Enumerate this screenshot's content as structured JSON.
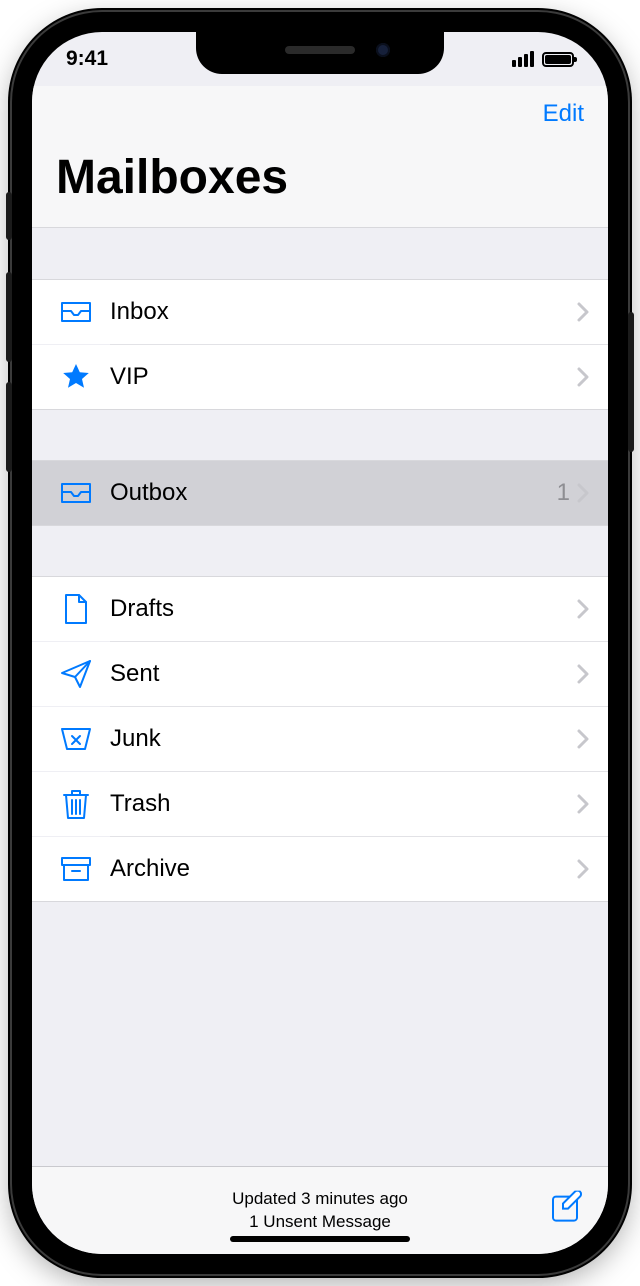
{
  "statusbar": {
    "time": "9:41"
  },
  "nav": {
    "edit": "Edit"
  },
  "title": "Mailboxes",
  "sections": [
    {
      "rows": [
        {
          "id": "inbox",
          "icon": "tray",
          "label": "Inbox",
          "count": "",
          "selected": false
        },
        {
          "id": "vip",
          "icon": "star",
          "label": "VIP",
          "count": "",
          "selected": false
        }
      ]
    },
    {
      "rows": [
        {
          "id": "outbox",
          "icon": "tray",
          "label": "Outbox",
          "count": "1",
          "selected": true
        }
      ]
    },
    {
      "rows": [
        {
          "id": "drafts",
          "icon": "doc",
          "label": "Drafts",
          "count": "",
          "selected": false
        },
        {
          "id": "sent",
          "icon": "plane",
          "label": "Sent",
          "count": "",
          "selected": false
        },
        {
          "id": "junk",
          "icon": "junk",
          "label": "Junk",
          "count": "",
          "selected": false
        },
        {
          "id": "trash",
          "icon": "trash",
          "label": "Trash",
          "count": "",
          "selected": false
        },
        {
          "id": "archive",
          "icon": "archive",
          "label": "Archive",
          "count": "",
          "selected": false
        }
      ]
    }
  ],
  "toolbar": {
    "status_line_1": "Updated 3 minutes ago",
    "status_line_2": "1 Unsent Message"
  }
}
